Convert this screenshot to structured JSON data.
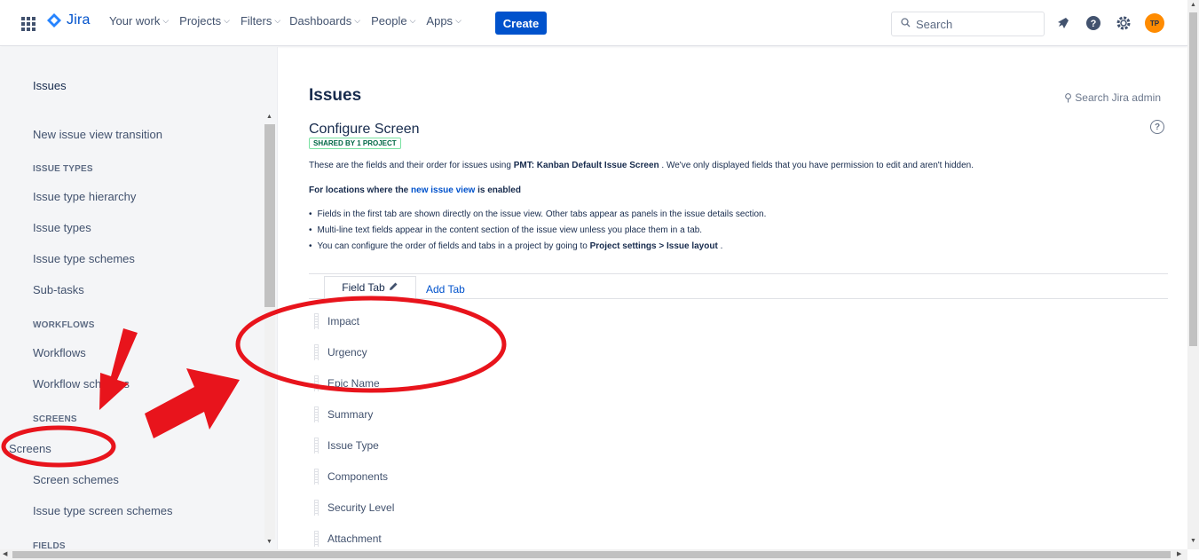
{
  "topnav": {
    "logo": "Jira",
    "items": [
      {
        "label": "Your work"
      },
      {
        "label": "Projects"
      },
      {
        "label": "Filters"
      },
      {
        "label": "Dashboards"
      },
      {
        "label": "People"
      },
      {
        "label": "Apps"
      }
    ],
    "create_label": "Create",
    "search_placeholder": "Search",
    "avatar_initials": "TP"
  },
  "sidebar": {
    "title": "Issues",
    "items": [
      {
        "type": "item",
        "label": "New issue view transition"
      },
      {
        "type": "section",
        "label": "ISSUE TYPES"
      },
      {
        "type": "item",
        "label": "Issue type hierarchy"
      },
      {
        "type": "item",
        "label": "Issue types"
      },
      {
        "type": "item",
        "label": "Issue type schemes"
      },
      {
        "type": "item",
        "label": "Sub-tasks"
      },
      {
        "type": "section",
        "label": "WORKFLOWS"
      },
      {
        "type": "item",
        "label": "Workflows"
      },
      {
        "type": "item",
        "label": "Workflow schemes"
      },
      {
        "type": "section",
        "label": "SCREENS"
      },
      {
        "type": "item",
        "label": "Screens"
      },
      {
        "type": "item",
        "label": "Screen schemes"
      },
      {
        "type": "item",
        "label": "Issue type screen schemes"
      },
      {
        "type": "section",
        "label": "FIELDS"
      }
    ]
  },
  "main": {
    "heading": "Issues",
    "search_admin": "Search Jira admin",
    "subheading": "Configure Screen",
    "badge": "SHARED BY 1 PROJECT",
    "desc_pre": "These are the fields and their order for issues using ",
    "desc_bold": "PMT: Kanban Default Issue Screen",
    "desc_post": " . We've only displayed fields that you have permission to edit and aren't hidden.",
    "loc_pre": "For locations where the ",
    "loc_link": "new issue view",
    "loc_post": " is enabled",
    "bullet1": "Fields in the first tab are shown directly on the issue view. Other tabs appear as panels in the issue details section.",
    "bullet2": "Multi-line text fields appear in the content section of the issue view unless you place them in a tab.",
    "bullet3_pre": "You can configure the order of fields and tabs in a project by going to ",
    "bullet3_bold": "Project settings > Issue layout",
    "bullet3_post": " .",
    "tab_label": "Field Tab",
    "add_tab": "Add Tab",
    "fields": [
      "Impact",
      "Urgency",
      "Epic Name",
      "Summary",
      "Issue Type",
      "Components",
      "Security Level",
      "Attachment"
    ]
  },
  "colors": {
    "brand": "#0052cc",
    "annotation": "#e8141c"
  }
}
